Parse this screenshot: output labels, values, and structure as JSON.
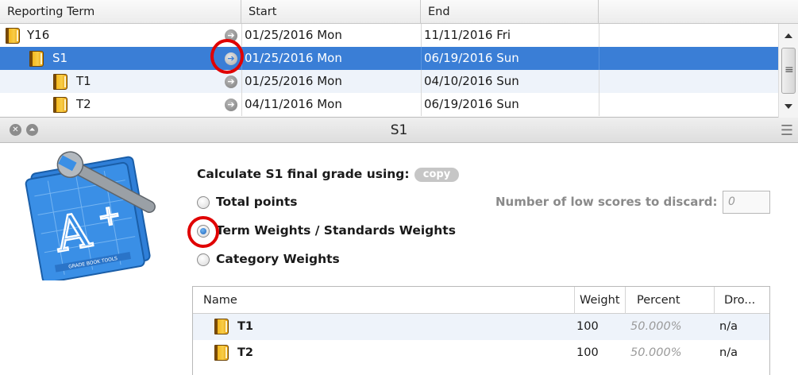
{
  "terms_table": {
    "headers": [
      "Reporting Term",
      "Start",
      "End",
      ""
    ],
    "rows": [
      {
        "name": "Y16",
        "start": "01/25/2016 Mon",
        "end": "11/11/2016 Fri"
      },
      {
        "name": "S1",
        "start": "01/25/2016 Mon",
        "end": "06/19/2016 Sun"
      },
      {
        "name": "T1",
        "start": "01/25/2016 Mon",
        "end": "04/10/2016 Sun"
      },
      {
        "name": "T2",
        "start": "04/11/2016 Mon",
        "end": "06/19/2016 Sun"
      }
    ]
  },
  "panel": {
    "title": "S1",
    "calc_label": "Calculate S1 final grade using:",
    "copy_label": "copy",
    "options": [
      "Total points",
      "Term Weights / Standards Weights",
      "Category Weights"
    ],
    "selected_option": 1,
    "discard_label": "Number of low scores to discard:",
    "discard_placeholder": "0"
  },
  "weights_table": {
    "headers": [
      "Name",
      "Weight",
      "Percent",
      "Dro..."
    ],
    "rows": [
      {
        "name": "T1",
        "weight": "100",
        "percent": "50.000%",
        "drop": "n/a"
      },
      {
        "name": "T2",
        "weight": "100",
        "percent": "50.000%",
        "drop": "n/a"
      }
    ]
  },
  "logo_text": "GRADE BOOK TOOLS",
  "colors": {
    "selection": "#3a7ed6",
    "highlight_ring": "#e00000",
    "folder": "#f4b81d"
  }
}
